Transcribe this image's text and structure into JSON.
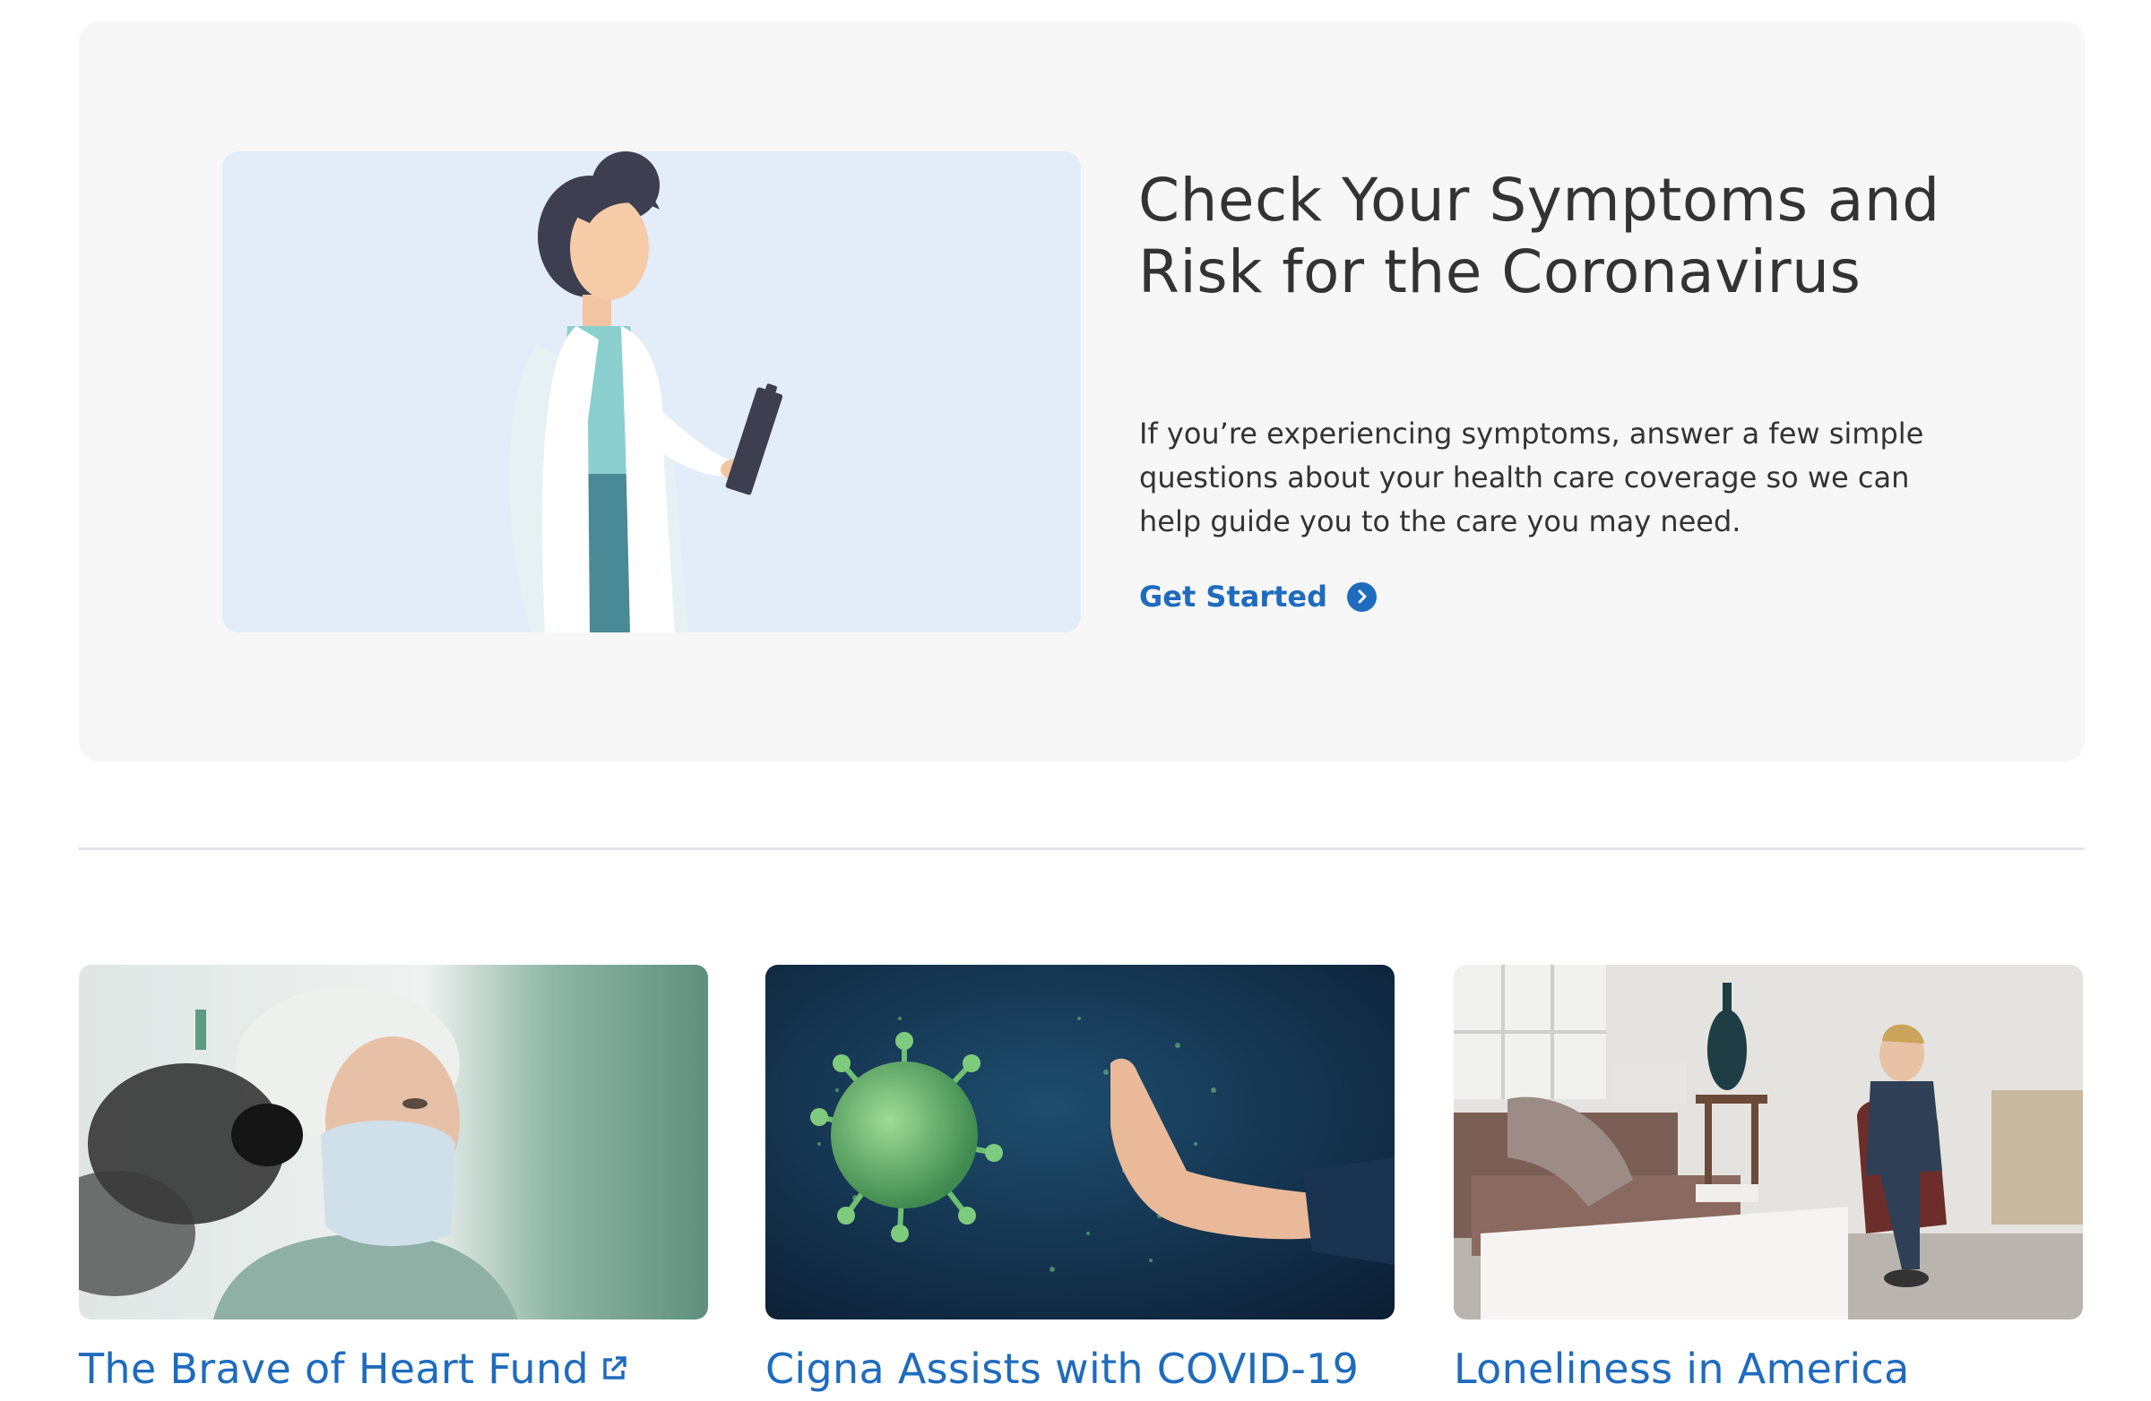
{
  "hero": {
    "title": "Check Your Symptoms and Risk for the Coronavirus",
    "body": "If you’re experiencing symptoms, answer a few simple questions about your health care coverage so we can help guide you to the care you may need.",
    "cta_label": "Get Started",
    "cta_icon": "chevron-right-circle-icon",
    "illustration": "doctor-with-clipboard-illustration"
  },
  "cards": [
    {
      "title": "The Brave of Heart Fund",
      "image": "surgeon-in-mask-photo",
      "icon": "external-link-icon"
    },
    {
      "title": "Cigna Assists with COVID-19",
      "image": "virus-and-hand-photo"
    },
    {
      "title": "Loneliness in America",
      "image": "woman-alone-in-living-room-photo"
    }
  ],
  "colors": {
    "link_blue": "#1f6bbd",
    "heading": "#333333",
    "hero_background": "#f7f7f7",
    "illustration_background": "#e3edf9",
    "divider": "#e2e5e8"
  }
}
